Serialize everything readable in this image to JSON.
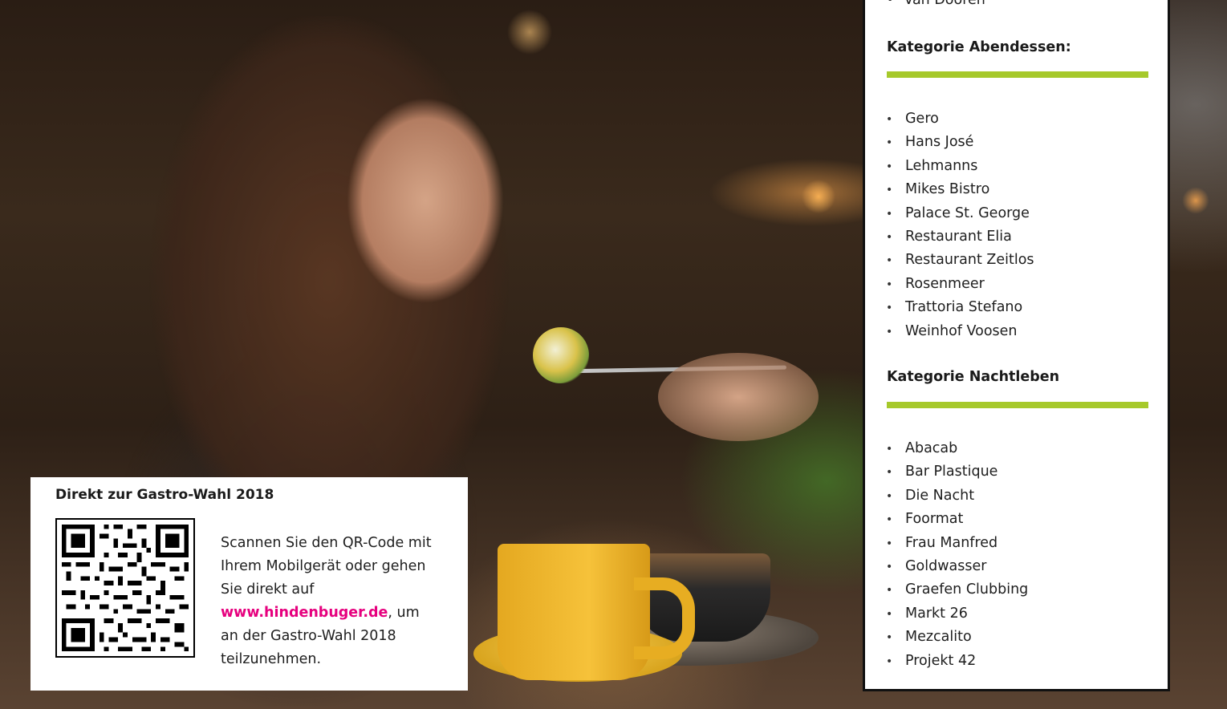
{
  "colors": {
    "accent_green": "#a6c92b",
    "link_magenta": "#e6007e"
  },
  "qr_card": {
    "title": "Direkt zur Gastro-Wahl 2018",
    "icon": "qr-code-icon",
    "text_before": "Scannen Sie den QR-Code mit Ihrem Mobilgerät oder gehen Sie direkt auf",
    "link": "www.hindenbuger.de",
    "text_after": ", um an der Gastro-Wahl 2018 teilzunehmen."
  },
  "panel": {
    "previous_item": "Van Dooren",
    "categories": [
      {
        "title": "Kategorie Abendessen:",
        "items": [
          "Gero",
          "Hans José",
          "Lehmanns",
          "Mikes Bistro",
          "Palace St. George",
          "Restaurant Elia",
          "Restaurant Zeitlos",
          "Rosenmeer",
          "Trattoria Stefano",
          "Weinhof Voosen"
        ]
      },
      {
        "title": "Kategorie Nachtleben",
        "items": [
          "Abacab",
          "Bar Plastique",
          "Die Nacht",
          "Foormat",
          "Frau Manfred",
          "Goldwasser",
          "Graefen Clubbing",
          "Markt 26",
          "Mezcalito",
          "Projekt 42"
        ]
      }
    ]
  }
}
